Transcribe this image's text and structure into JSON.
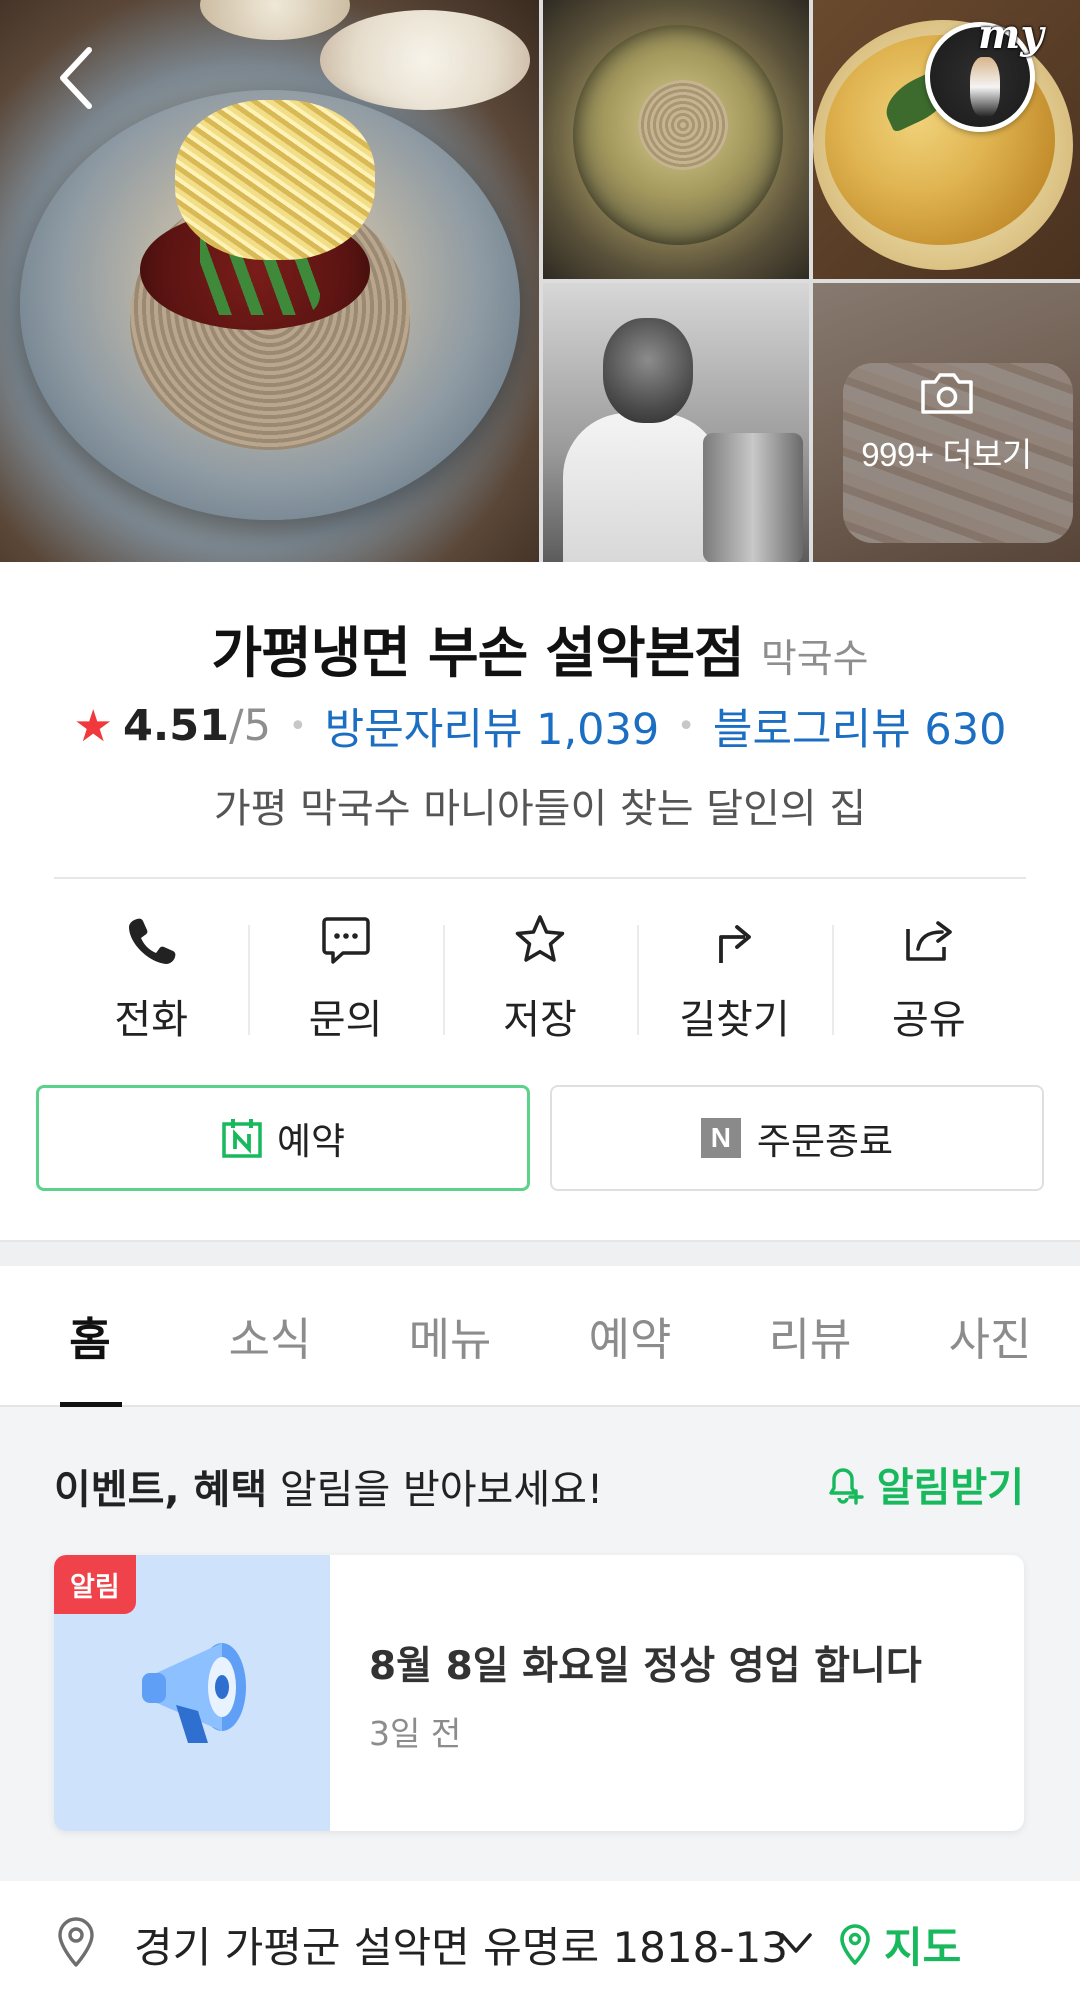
{
  "gallery": {
    "more_label": "999+ 더보기",
    "my_badge": "my"
  },
  "place": {
    "name": "가평냉면 부손 설악본점",
    "category": "막국수",
    "rating": "4.51",
    "rating_max": "/5",
    "visitor_reviews": "방문자리뷰 1,039",
    "blog_reviews": "블로그리뷰 630",
    "tagline": "가평 막국수 마니아들이 찾는 달인의 집"
  },
  "actions": [
    {
      "label": "전화",
      "icon": "phone-icon"
    },
    {
      "label": "문의",
      "icon": "chat-icon"
    },
    {
      "label": "저장",
      "icon": "star-outline-icon"
    },
    {
      "label": "길찾기",
      "icon": "directions-icon"
    },
    {
      "label": "공유",
      "icon": "share-icon"
    }
  ],
  "booking": {
    "reserve_label": "예약",
    "order_label": "주문종료",
    "n_letter": "N"
  },
  "tabs": [
    "홈",
    "소식",
    "메뉴",
    "예약",
    "리뷰",
    "사진"
  ],
  "event": {
    "heading_bold": "이벤트, 혜택",
    "heading_rest": " 알림을 받아보세요!",
    "alarm_label": "알림받기",
    "notice": {
      "badge": "알림",
      "title": "8월 8일 화요일 정상 영업 합니다",
      "time": "3일 전"
    }
  },
  "address": {
    "text": "경기 가평군 설악면 유명로 1818-13",
    "map_label": "지도"
  },
  "colors": {
    "brand_green": "#17b95c",
    "link_blue": "#1b6ec2",
    "star_red": "#f0383d",
    "badge_red": "#f0424a"
  }
}
